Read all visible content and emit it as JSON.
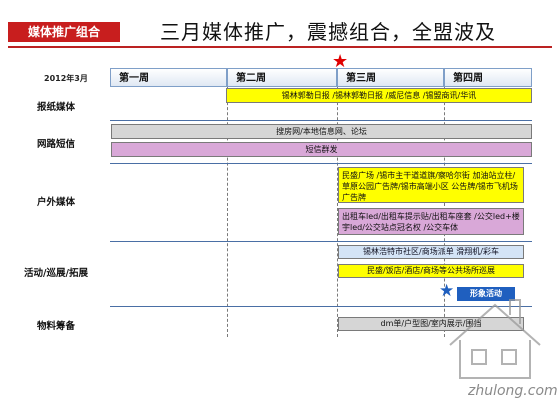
{
  "header": {
    "tag": "媒体推广组合",
    "title": "三月媒体推广，震撼组合，全盟波及"
  },
  "timeline": {
    "year_label": "2012年3月",
    "weeks": [
      "第一周",
      "第二周",
      "第三周",
      "第四周"
    ]
  },
  "rows": {
    "newspaper": "报纸媒体",
    "web_sms": "网路短信",
    "outdoor": "户外媒体",
    "events": "活动/巡展/拓展",
    "materials": "物料筹备"
  },
  "bars": {
    "newspaper": "锡林郭勒日报 /锡林郭勒日报 /威尼信息 /锡盟商讯/华讯",
    "web": "搜房网/本地信息网、论坛",
    "sms": "短信群发",
    "outdoor_1": "民盛广场 /锡市主干道道旗/察哈尔街 加油站立柱/草原公园广告牌/锡市高端小区 公告牌/锡市飞机场广告牌",
    "outdoor_2": "出租车led/出租车提示贴/出租车座套 /公交led+楼宇led/公交站点冠名权 /公交车体",
    "events_1": "锡林浩特市社区/商场派单 滑翔机/彩车",
    "events_2": "民盛/饭店/酒店/商场等公共场所巡展",
    "events_3": "形象活动",
    "materials": "dm单/户型图/室内展示/围挡"
  },
  "watermark": "zhulong.com",
  "colors": {
    "tag_bg": "#c81e1e",
    "week_border": "#7f9fc8",
    "bar_yellow": "#ffff00",
    "bar_grey": "#d6d6d6",
    "bar_pink": "#d9a8d8",
    "bar_sky": "#d4e4f6",
    "star": "#e00000",
    "blue": "#1f5fbf"
  }
}
